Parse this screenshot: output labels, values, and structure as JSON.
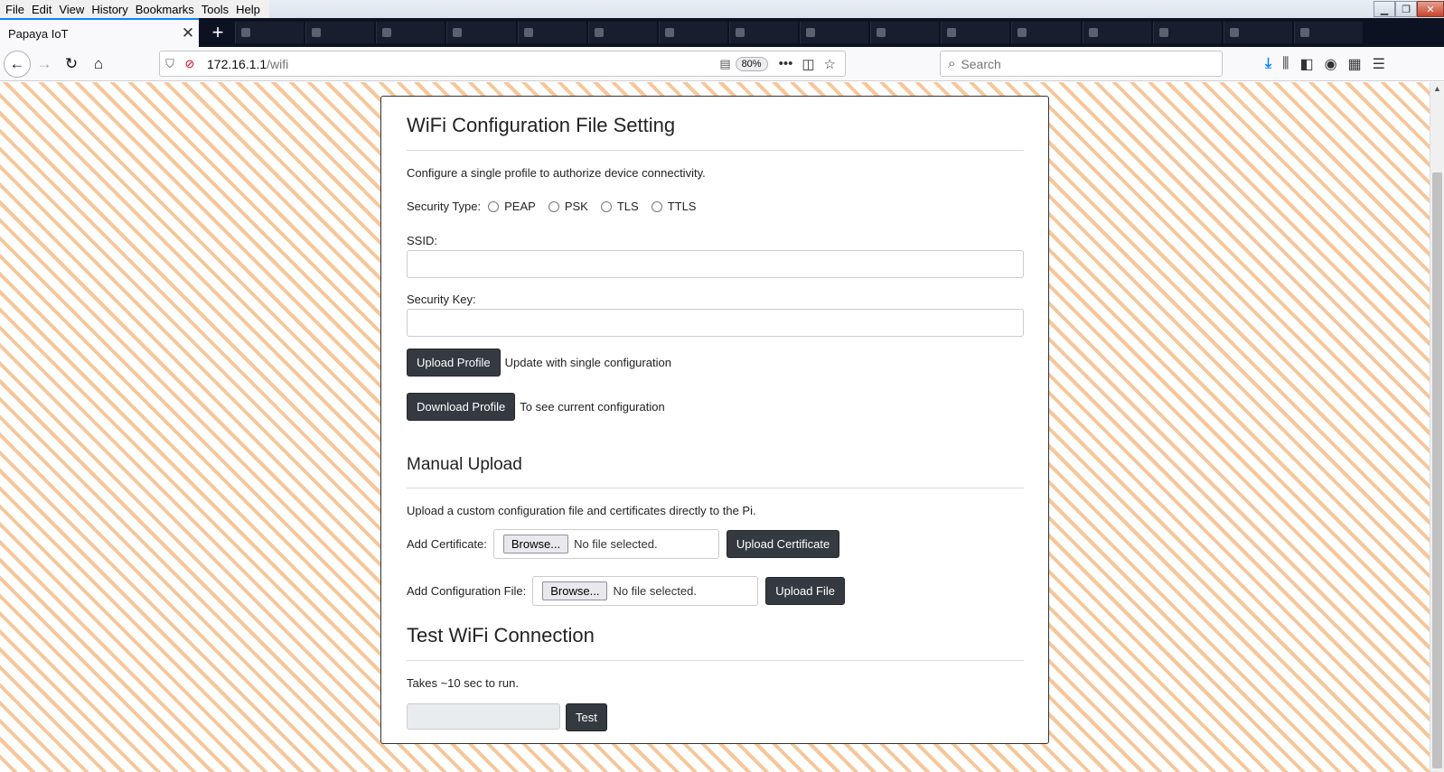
{
  "menubar": {
    "items": [
      {
        "accel": "F",
        "rest": "ile"
      },
      {
        "accel": "E",
        "rest": "dit"
      },
      {
        "accel": "V",
        "rest": "iew"
      },
      {
        "accel": "",
        "pre": "Hi",
        "accel2": "s",
        "rest": "tory"
      },
      {
        "accel": "B",
        "rest": "ookmarks"
      },
      {
        "accel": "T",
        "rest": "ools"
      },
      {
        "accel": "H",
        "rest": "elp"
      }
    ],
    "labels": [
      "File",
      "Edit",
      "View",
      "History",
      "Bookmarks",
      "Tools",
      "Help"
    ]
  },
  "tabs": {
    "active_title": "Papaya IoT",
    "close_glyph": "✕",
    "new_tab_glyph": "+"
  },
  "nav": {
    "url_host": "172.16.1.1",
    "url_path": "/wifi",
    "zoom": "80%",
    "search_placeholder": "Search"
  },
  "wifi_config": {
    "title": "WiFi Configuration File Setting",
    "description": "Configure a single profile to authorize device connectivity.",
    "security_type_label": "Security Type:",
    "security_options": [
      "PEAP",
      "PSK",
      "TLS",
      "TTLS"
    ],
    "ssid_label": "SSID:",
    "ssid_value": "",
    "security_key_label": "Security Key:",
    "security_key_value": "",
    "upload_profile_button": "Upload Profile",
    "upload_profile_hint": "Update with single configuration",
    "download_profile_button": "Download Profile",
    "download_profile_hint": "To see current configuration"
  },
  "manual_upload": {
    "title": "Manual Upload",
    "description": "Upload a custom configuration file and certificates directly to the Pi.",
    "certificate_label": "Add Certificate:",
    "browse_label": "Browse...",
    "no_file_text": "No file selected.",
    "upload_certificate_button": "Upload Certificate",
    "config_file_label": "Add Configuration File:",
    "upload_file_button": "Upload File"
  },
  "test_connection": {
    "title": "Test WiFi Connection",
    "description": "Takes ~10 sec to run.",
    "result_value": "",
    "test_button": "Test"
  }
}
